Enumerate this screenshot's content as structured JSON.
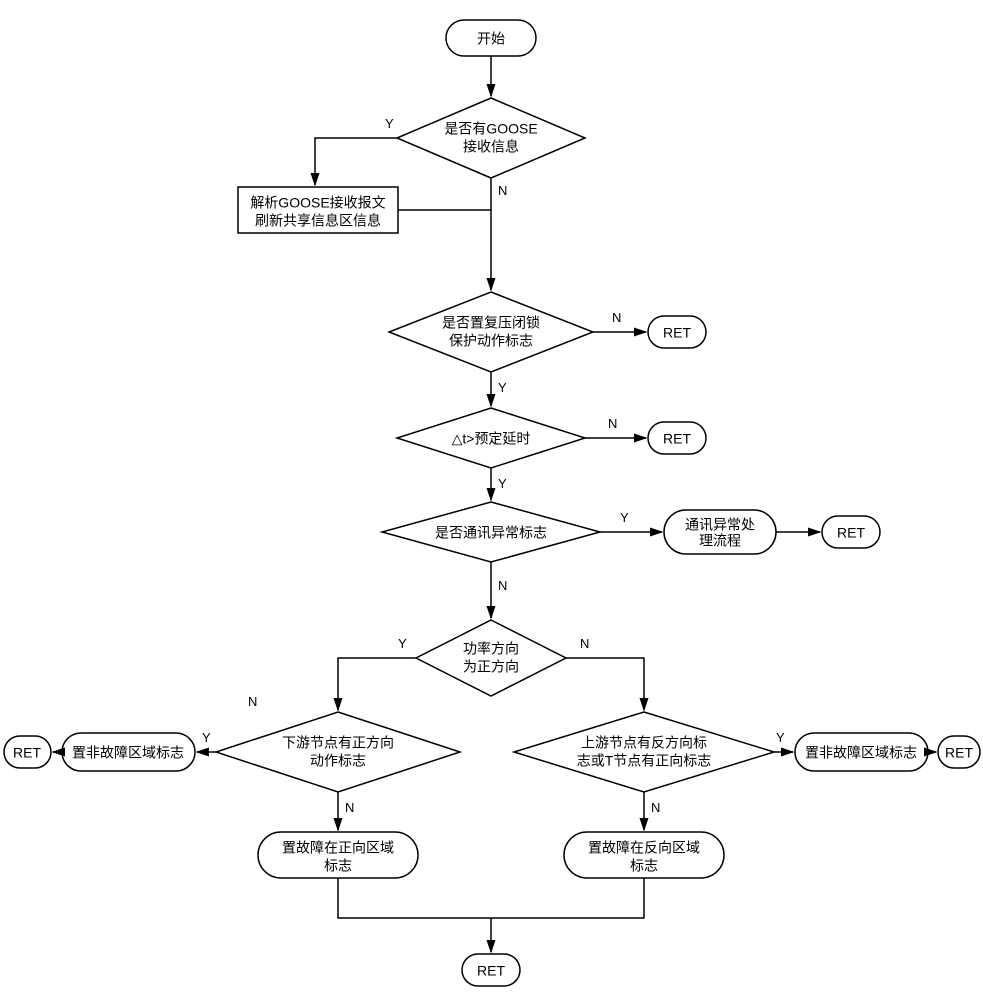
{
  "nodes": {
    "start": "开始",
    "d1_l1": "是否有GOOSE",
    "d1_l2": "接收信息",
    "p1_l1": "解析GOOSE接收报文",
    "p1_l2": "刷新共享信息区信息",
    "d2_l1": "是否置复压闭锁",
    "d2_l2": "保护动作标志",
    "d3": "△t>预定延时",
    "d4": "是否通讯异常标志",
    "p2_l1": "通讯异常处",
    "p2_l2": "理流程",
    "d5_l1": "功率方向",
    "d5_l2": "为正方向",
    "d6_l1": "下游节点有正方向",
    "d6_l2": "动作标志",
    "d7_l1": "上游节点有反方向标",
    "d7_l2": "志或T节点有正向标志",
    "t_left_l1": "置非故障区域标志",
    "t_right_l1": "置非故障区域标志",
    "t_fwd_l1": "置故障在正向区域",
    "t_fwd_l2": "标志",
    "t_rev_l1": "置故障在反向区域",
    "t_rev_l2": "标志",
    "ret": "RET"
  },
  "labels": {
    "Y": "Y",
    "N": "N"
  }
}
